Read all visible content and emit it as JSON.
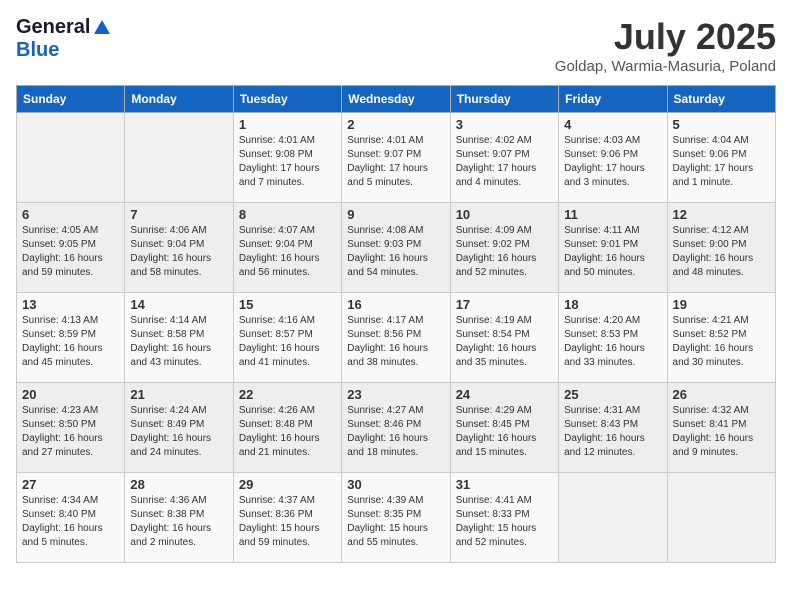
{
  "header": {
    "logo_general": "General",
    "logo_blue": "Blue",
    "month_title": "July 2025",
    "location": "Goldap, Warmia-Masuria, Poland"
  },
  "weekdays": [
    "Sunday",
    "Monday",
    "Tuesday",
    "Wednesday",
    "Thursday",
    "Friday",
    "Saturday"
  ],
  "weeks": [
    [
      {
        "day": "",
        "info": ""
      },
      {
        "day": "",
        "info": ""
      },
      {
        "day": "1",
        "info": "Sunrise: 4:01 AM\nSunset: 9:08 PM\nDaylight: 17 hours and 7 minutes."
      },
      {
        "day": "2",
        "info": "Sunrise: 4:01 AM\nSunset: 9:07 PM\nDaylight: 17 hours and 5 minutes."
      },
      {
        "day": "3",
        "info": "Sunrise: 4:02 AM\nSunset: 9:07 PM\nDaylight: 17 hours and 4 minutes."
      },
      {
        "day": "4",
        "info": "Sunrise: 4:03 AM\nSunset: 9:06 PM\nDaylight: 17 hours and 3 minutes."
      },
      {
        "day": "5",
        "info": "Sunrise: 4:04 AM\nSunset: 9:06 PM\nDaylight: 17 hours and 1 minute."
      }
    ],
    [
      {
        "day": "6",
        "info": "Sunrise: 4:05 AM\nSunset: 9:05 PM\nDaylight: 16 hours and 59 minutes."
      },
      {
        "day": "7",
        "info": "Sunrise: 4:06 AM\nSunset: 9:04 PM\nDaylight: 16 hours and 58 minutes."
      },
      {
        "day": "8",
        "info": "Sunrise: 4:07 AM\nSunset: 9:04 PM\nDaylight: 16 hours and 56 minutes."
      },
      {
        "day": "9",
        "info": "Sunrise: 4:08 AM\nSunset: 9:03 PM\nDaylight: 16 hours and 54 minutes."
      },
      {
        "day": "10",
        "info": "Sunrise: 4:09 AM\nSunset: 9:02 PM\nDaylight: 16 hours and 52 minutes."
      },
      {
        "day": "11",
        "info": "Sunrise: 4:11 AM\nSunset: 9:01 PM\nDaylight: 16 hours and 50 minutes."
      },
      {
        "day": "12",
        "info": "Sunrise: 4:12 AM\nSunset: 9:00 PM\nDaylight: 16 hours and 48 minutes."
      }
    ],
    [
      {
        "day": "13",
        "info": "Sunrise: 4:13 AM\nSunset: 8:59 PM\nDaylight: 16 hours and 45 minutes."
      },
      {
        "day": "14",
        "info": "Sunrise: 4:14 AM\nSunset: 8:58 PM\nDaylight: 16 hours and 43 minutes."
      },
      {
        "day": "15",
        "info": "Sunrise: 4:16 AM\nSunset: 8:57 PM\nDaylight: 16 hours and 41 minutes."
      },
      {
        "day": "16",
        "info": "Sunrise: 4:17 AM\nSunset: 8:56 PM\nDaylight: 16 hours and 38 minutes."
      },
      {
        "day": "17",
        "info": "Sunrise: 4:19 AM\nSunset: 8:54 PM\nDaylight: 16 hours and 35 minutes."
      },
      {
        "day": "18",
        "info": "Sunrise: 4:20 AM\nSunset: 8:53 PM\nDaylight: 16 hours and 33 minutes."
      },
      {
        "day": "19",
        "info": "Sunrise: 4:21 AM\nSunset: 8:52 PM\nDaylight: 16 hours and 30 minutes."
      }
    ],
    [
      {
        "day": "20",
        "info": "Sunrise: 4:23 AM\nSunset: 8:50 PM\nDaylight: 16 hours and 27 minutes."
      },
      {
        "day": "21",
        "info": "Sunrise: 4:24 AM\nSunset: 8:49 PM\nDaylight: 16 hours and 24 minutes."
      },
      {
        "day": "22",
        "info": "Sunrise: 4:26 AM\nSunset: 8:48 PM\nDaylight: 16 hours and 21 minutes."
      },
      {
        "day": "23",
        "info": "Sunrise: 4:27 AM\nSunset: 8:46 PM\nDaylight: 16 hours and 18 minutes."
      },
      {
        "day": "24",
        "info": "Sunrise: 4:29 AM\nSunset: 8:45 PM\nDaylight: 16 hours and 15 minutes."
      },
      {
        "day": "25",
        "info": "Sunrise: 4:31 AM\nSunset: 8:43 PM\nDaylight: 16 hours and 12 minutes."
      },
      {
        "day": "26",
        "info": "Sunrise: 4:32 AM\nSunset: 8:41 PM\nDaylight: 16 hours and 9 minutes."
      }
    ],
    [
      {
        "day": "27",
        "info": "Sunrise: 4:34 AM\nSunset: 8:40 PM\nDaylight: 16 hours and 5 minutes."
      },
      {
        "day": "28",
        "info": "Sunrise: 4:36 AM\nSunset: 8:38 PM\nDaylight: 16 hours and 2 minutes."
      },
      {
        "day": "29",
        "info": "Sunrise: 4:37 AM\nSunset: 8:36 PM\nDaylight: 15 hours and 59 minutes."
      },
      {
        "day": "30",
        "info": "Sunrise: 4:39 AM\nSunset: 8:35 PM\nDaylight: 15 hours and 55 minutes."
      },
      {
        "day": "31",
        "info": "Sunrise: 4:41 AM\nSunset: 8:33 PM\nDaylight: 15 hours and 52 minutes."
      },
      {
        "day": "",
        "info": ""
      },
      {
        "day": "",
        "info": ""
      }
    ]
  ]
}
